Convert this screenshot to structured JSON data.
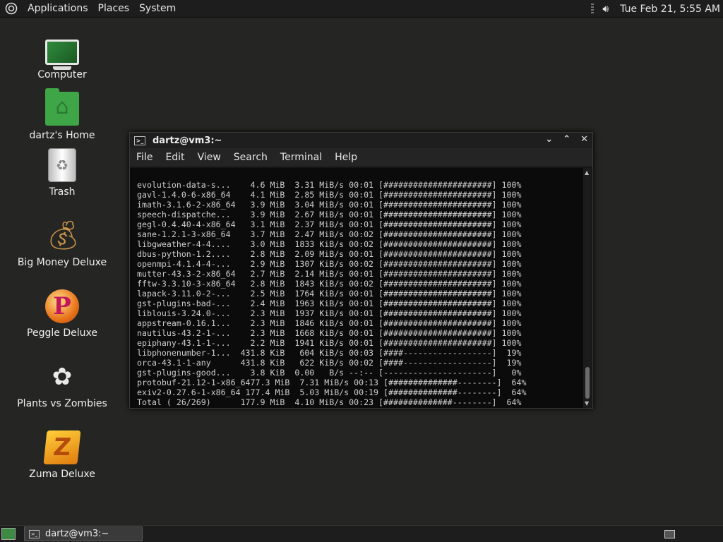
{
  "top_panel": {
    "menus": [
      "Applications",
      "Places",
      "System"
    ],
    "clock": "Tue Feb 21,  5:55 AM"
  },
  "desktop_icons": [
    {
      "label": "Computer",
      "icon": "computer-icon"
    },
    {
      "label": "dartz's Home",
      "icon": "home-folder-icon"
    },
    {
      "label": "Trash",
      "icon": "trash-icon"
    },
    {
      "label": "Big Money Deluxe",
      "icon": "money-bag-icon"
    },
    {
      "label": "Peggle Deluxe",
      "icon": "peggle-icon"
    },
    {
      "label": "Plants vs Zombies",
      "icon": "plants-icon"
    },
    {
      "label": "Zuma Deluxe",
      "icon": "zuma-icon"
    }
  ],
  "terminal": {
    "title": "dartz@vm3:~",
    "menu": [
      "File",
      "Edit",
      "View",
      "Search",
      "Terminal",
      "Help"
    ],
    "lines": [
      "evolution-data-s...    4.6 MiB  3.31 MiB/s 00:01 [######################] 100%",
      "gavl-1.4.0-6-x86_64    4.1 MiB  2.85 MiB/s 00:01 [######################] 100%",
      "imath-3.1.6-2-x86_64   3.9 MiB  3.04 MiB/s 00:01 [######################] 100%",
      "speech-dispatche...    3.9 MiB  2.67 MiB/s 00:01 [######################] 100%",
      "gegl-0.4.40-4-x86_64   3.1 MiB  2.37 MiB/s 00:01 [######################] 100%",
      "sane-1.2.1-3-x86_64    3.7 MiB  2.47 MiB/s 00:02 [######################] 100%",
      "libgweather-4-4....    3.0 MiB  1833 KiB/s 00:02 [######################] 100%",
      "dbus-python-1.2....    2.8 MiB  2.09 MiB/s 00:01 [######################] 100%",
      "openmpi-4.1.4-4-...    2.9 MiB  1307 KiB/s 00:02 [######################] 100%",
      "mutter-43.3-2-x86_64   2.7 MiB  2.14 MiB/s 00:01 [######################] 100%",
      "fftw-3.3.10-3-x86_64   2.8 MiB  1843 KiB/s 00:02 [######################] 100%",
      "lapack-3.11.0-2-...    2.5 MiB  1764 KiB/s 00:01 [######################] 100%",
      "gst-plugins-bad-...    2.4 MiB  1963 KiB/s 00:01 [######################] 100%",
      "liblouis-3.24.0-...    2.3 MiB  1937 KiB/s 00:01 [######################] 100%",
      "appstream-0.16.1...    2.3 MiB  1846 KiB/s 00:01 [######################] 100%",
      "nautilus-43.2-1-...    2.3 MiB  1668 KiB/s 00:01 [######################] 100%",
      "epiphany-43.1-1-...    2.2 MiB  1941 KiB/s 00:01 [######################] 100%",
      "libphonenumber-1...  431.8 KiB   604 KiB/s 00:03 [####------------------]  19%",
      "orca-43.1-1-any      431.8 KiB   622 KiB/s 00:02 [####------------------]  19%",
      "gst-plugins-good...    3.8 KiB  0.00   B/s --:-- [----------------------]   0%",
      "protobuf-21.12-1-x86_6477.3 MiB  7.31 MiB/s 00:13 [##############--------]  64%",
      "exiv2-0.27.6-1-x86_64 177.4 MiB  5.03 MiB/s 00:19 [##############--------]  64%",
      "Total ( 26/269)      177.9 MiB  4.10 MiB/s 00:23 [##############--------]  64%"
    ]
  },
  "bottom_panel": {
    "task_label": "dartz@vm3:~"
  }
}
